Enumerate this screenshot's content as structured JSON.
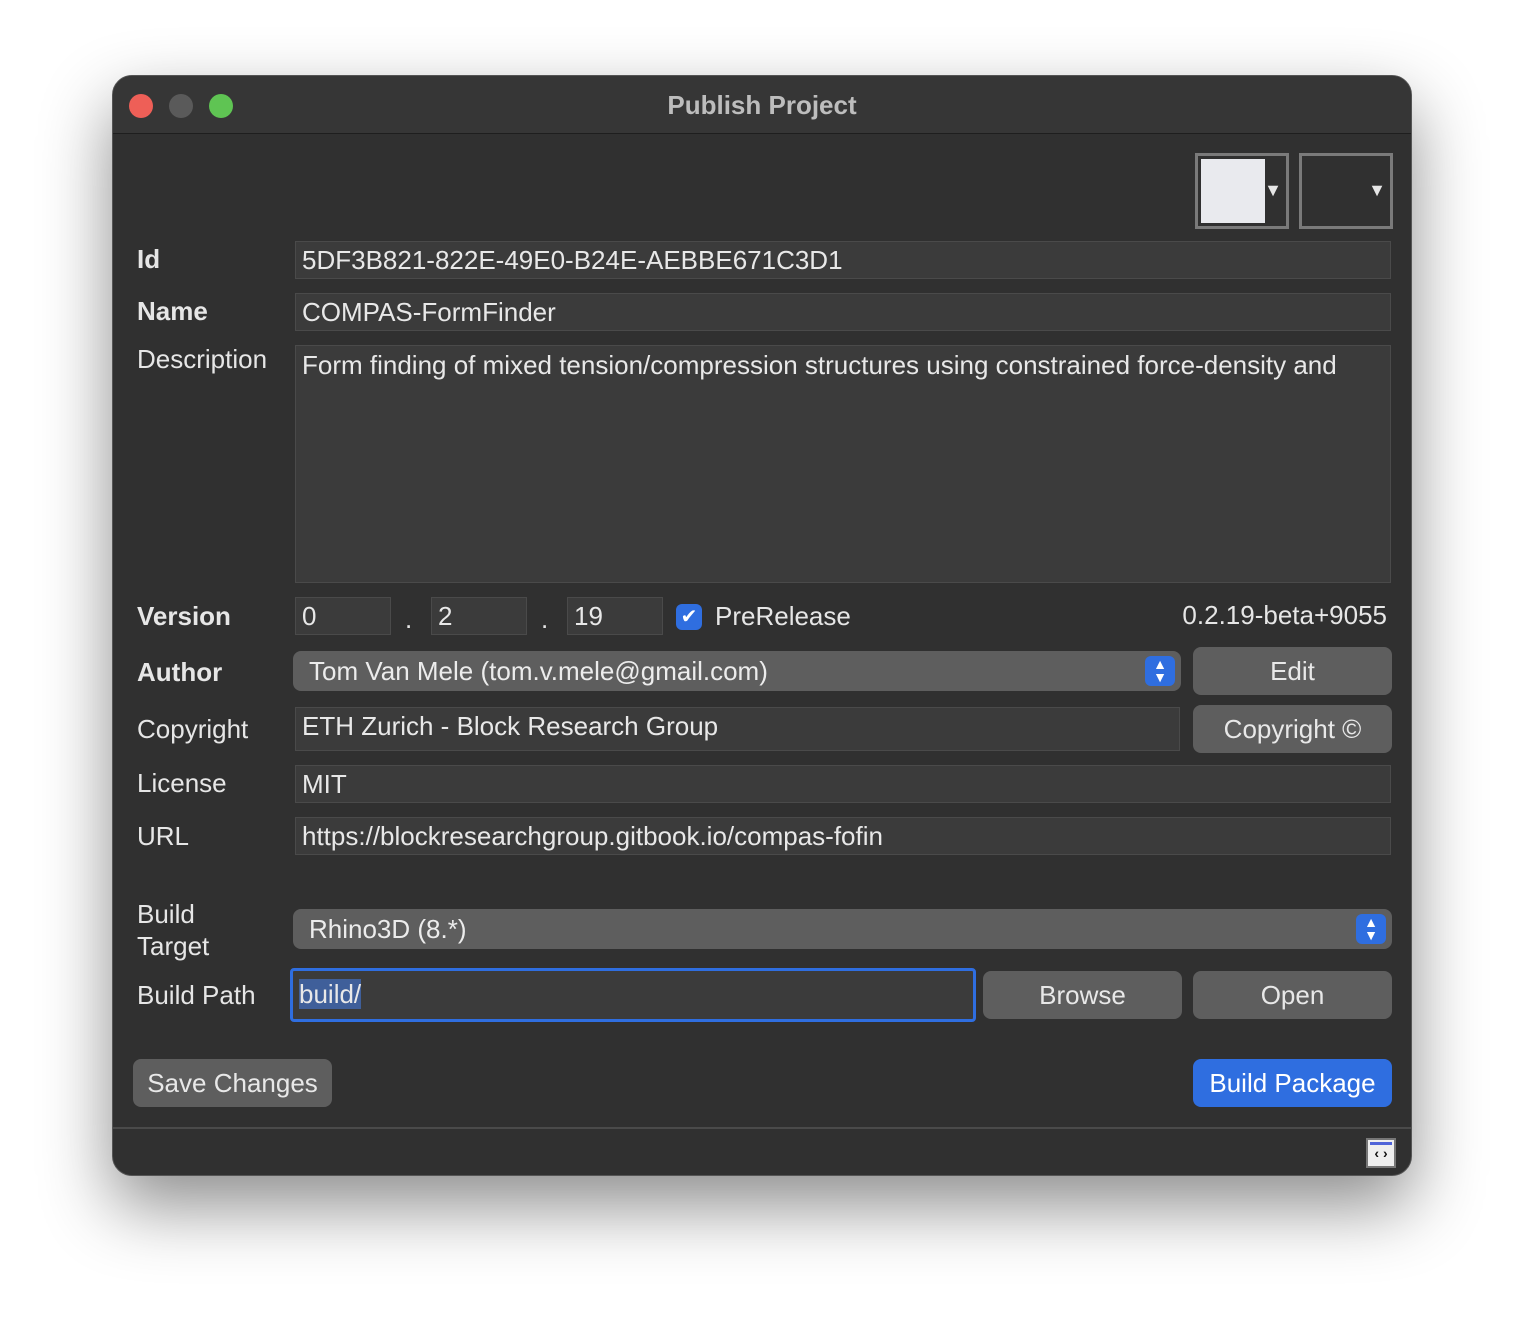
{
  "window": {
    "title": "Publish Project",
    "traffic_lights": {
      "close": "#ee5f57",
      "minimize": "#5a5a5a",
      "zoom": "#5fc453"
    }
  },
  "toolbar": {
    "color_dropdown_1": "#e9eaee",
    "dropdown_arrow": "▼"
  },
  "form": {
    "id_label": "Id",
    "id_value": "5DF3B821-822E-49E0-B24E-AEBBE671C3D1",
    "name_label": "Name",
    "name_value": "COMPAS-FormFinder",
    "description_label": "Description",
    "description_value": "Form finding of mixed tension/compression structures using constrained force-density and",
    "version_label": "Version",
    "version_major": "0",
    "version_minor": "2",
    "version_patch": "19",
    "version_sep": ".",
    "prerelease_label": "PreRelease",
    "prerelease_checked": true,
    "version_string": "0.2.19-beta+9055",
    "author_label": "Author",
    "author_value": "Tom Van Mele (tom.v.mele@gmail.com)",
    "edit_label": "Edit",
    "copyright_label": "Copyright",
    "copyright_value": "ETH Zurich - Block Research Group",
    "copyright_button": "Copyright ©",
    "license_label": "License",
    "license_value": "MIT",
    "url_label": "URL",
    "url_value": "https://blockresearchgroup.gitbook.io/compas-fofin",
    "build_target_label_1": "Build",
    "build_target_label_2": "Target",
    "build_target_value": "Rhino3D (8.*)",
    "build_path_label": "Build Path",
    "build_path_value": "build/",
    "browse_label": "Browse",
    "open_label": "Open"
  },
  "footer": {
    "save_label": "Save Changes",
    "build_label": "Build Package",
    "accent": "#2f6ee0"
  }
}
